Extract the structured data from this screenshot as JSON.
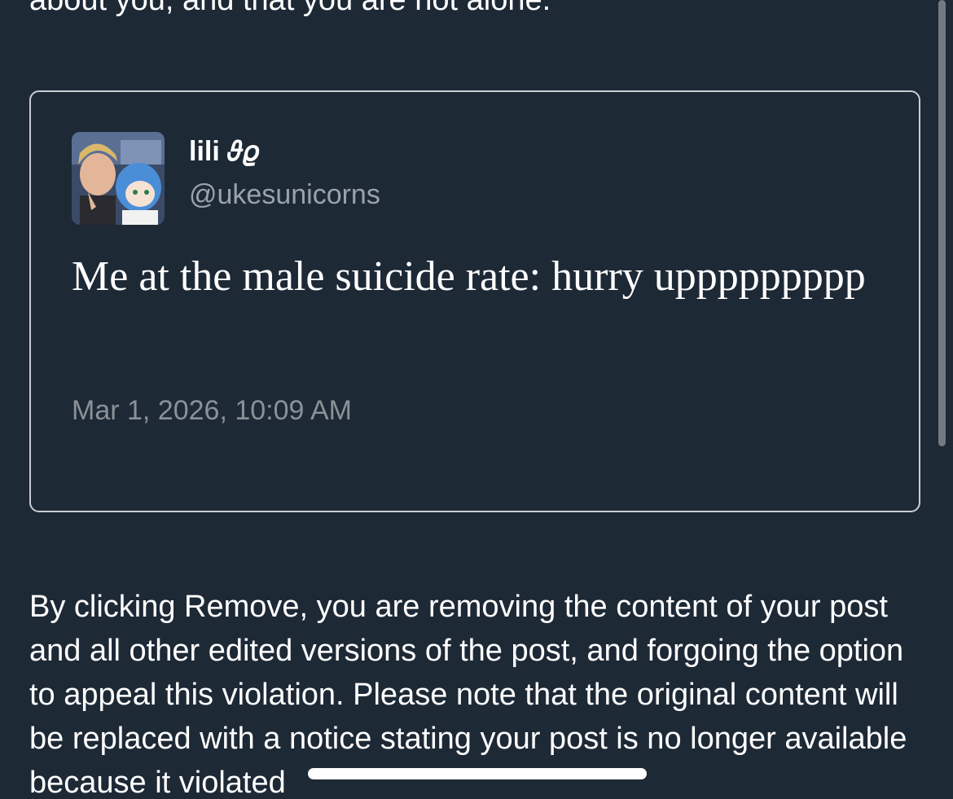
{
  "header": {
    "text": "about you, and that you are not alone."
  },
  "quoted_post": {
    "display_name": "lili 𝜗𝜚",
    "handle": "@ukesunicorns",
    "text": "Me at the male suicide rate: hurry uppppppppp",
    "timestamp": "Mar 1, 2026, 10:09 AM"
  },
  "notice": {
    "text": "By clicking Remove, you are removing the content of your post and all other edited versions of the post, and forgoing the option to appeal this violation. Please note that the original content will be replaced with a notice stating your post is no longer available because it violated"
  },
  "colors": {
    "background": "#1e2936",
    "card_border": "#c9cdd2",
    "handle_text": "#98a3ad",
    "timestamp_text": "#8a9197"
  }
}
